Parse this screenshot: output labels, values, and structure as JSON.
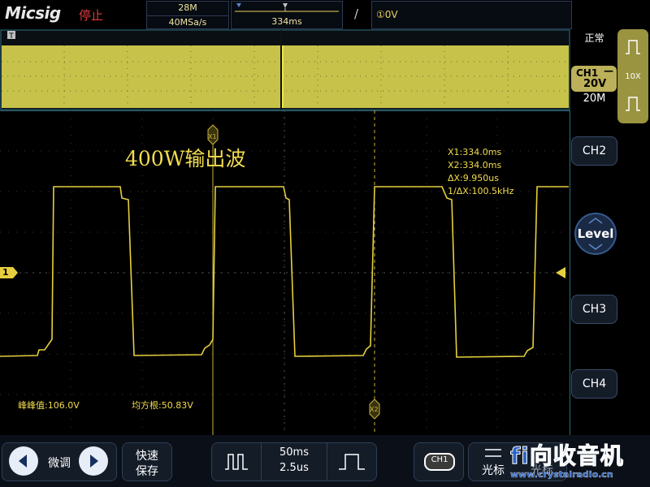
{
  "header": {
    "brand": "Micsig",
    "run_status": "停止",
    "memory_depth": "28M",
    "sample_rate": "40MSa/s",
    "time_position": "334ms",
    "trigger_slope_symbol": "/",
    "trigger_level": "①0V"
  },
  "overview": {
    "trace_color": "#c7c24a"
  },
  "right_panel": {
    "trigger_mode": "正常",
    "ch1_label": "CH1",
    "ch1_coupling_symbol": "—",
    "ch1_scale": "20V",
    "bandwidth": "20M",
    "probe_ratio": "10X",
    "ch2_label": "CH2",
    "level_label": "Level",
    "ch3_label": "CH3",
    "ch4_label": "CH4"
  },
  "waveform": {
    "annotation": "400W输出波",
    "channel_marker": "1",
    "cursor_x1_label": "X1",
    "cursor_x2_label": "X2",
    "trace_color": "#e6cf3e",
    "measurements": {
      "x1": "X1:334.0ms",
      "x2": "X2:334.0ms",
      "dx": "ΔX:9.950us",
      "inv_dx": "1/ΔX:100.5kHz"
    },
    "peak_to_peak": "峰峰值:106.0V",
    "rms": "均方根:50.83V"
  },
  "bottom_bar": {
    "fine_label": "微调",
    "quick_save_line1": "快速",
    "quick_save_line2": "保存",
    "timebase_main": "50ms",
    "timebase_zoom": "2.5us",
    "ch1_button": "CH1",
    "cursor_label": "光标",
    "meas_label": "光标"
  },
  "watermark": {
    "text": "fi向收音机",
    "url": "www.crystalradio.cn"
  }
}
